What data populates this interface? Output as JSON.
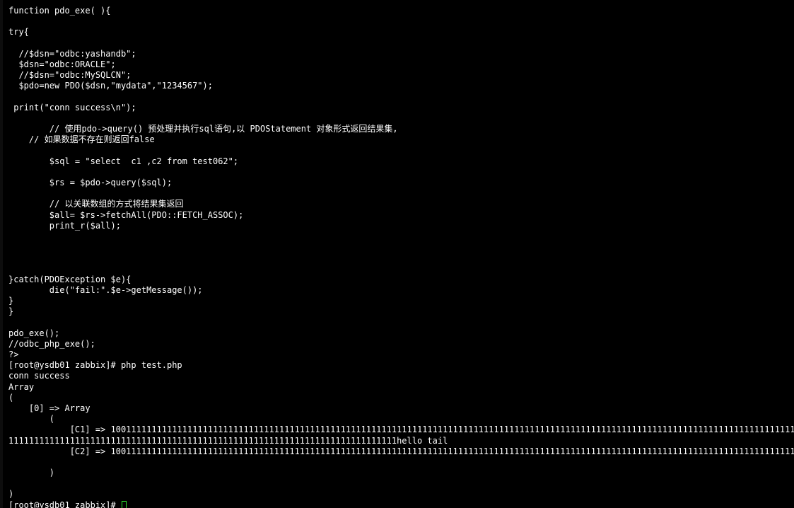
{
  "colors": {
    "background": "#000000",
    "text": "#ffffff",
    "cursor": "#2ee62e"
  },
  "terminal": {
    "lines": [
      "function pdo_exe( ){",
      "",
      "try{",
      "",
      "  //$dsn=\"odbc:yashandb\";",
      "  $dsn=\"odbc:ORACLE\";",
      "  //$dsn=\"odbc:MySQLCN\";",
      "  $pdo=new PDO($dsn,\"mydata\",\"1234567\");",
      "",
      " print(\"conn success\\n\");",
      "",
      "        // 使用pdo->query() 预处理并执行sql语句,以 PDOStatement 对象形式返回结果集,",
      "    // 如果数据不存在则返回false",
      "",
      "        $sql = \"select  c1 ,c2 from test062\";",
      "",
      "        $rs = $pdo->query($sql);",
      "",
      "        // 以关联数组的方式将结果集返回",
      "        $all= $rs->fetchAll(PDO::FETCH_ASSOC);",
      "        print_r($all);",
      "",
      "",
      "",
      "",
      "}catch(PDOException $e){",
      "        die(\"fail:\".$e->getMessage());",
      "}",
      "}",
      "",
      "pdo_exe();",
      "//odbc_php_exe();",
      "?>",
      "[root@ysdb01 zabbix]# php test.php",
      "conn success",
      "Array",
      "(",
      "    [0] => Array",
      "        (",
      "            [C1] => 1001111111111111111111111111111111111111111111111111111111111111111111111111111111111111111111111111111111111111111111111111111111111111",
      "1111111111111111111111111111111111111111111111111111111111111111111111111111hello tail",
      "            [C2] => 1001111111111111111111111111111111111111111111111111111111111111111111111111111111111111111111111111111111111111111111111111111111111111",
      "",
      "        )",
      "",
      ")"
    ],
    "prompt": "[root@ysdb01 zabbix]# "
  }
}
